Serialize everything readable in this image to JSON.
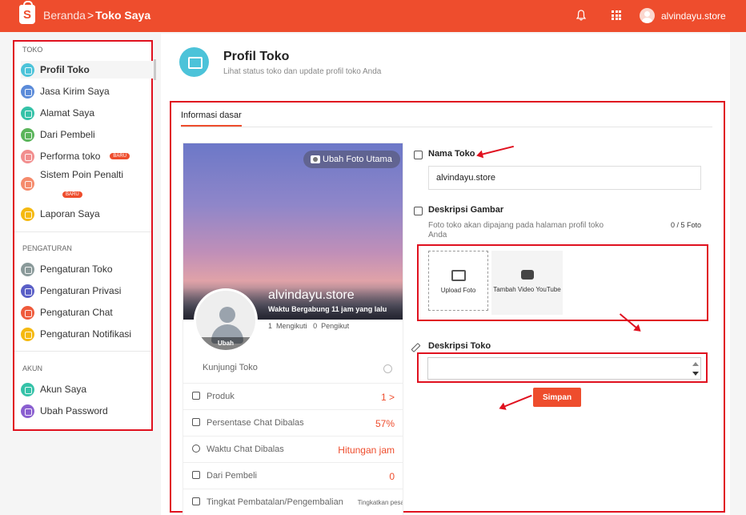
{
  "topbar": {
    "logo_letter": "S",
    "breadcrumb_home": "Beranda",
    "breadcrumb_sep": ">",
    "breadcrumb_current": "Toko Saya",
    "user_name": "alvindayu.store"
  },
  "sidebar": {
    "section_toko": "TOKO",
    "section_pengaturan": "PENGATURAN",
    "section_akun": "AKUN",
    "badge_new": "BARU",
    "toko_items": [
      {
        "label": "Profil Toko",
        "color": "#4cc3d9"
      },
      {
        "label": "Jasa Kirim Saya",
        "color": "#5b8bd9"
      },
      {
        "label": "Alamat Saya",
        "color": "#35c2a8"
      },
      {
        "label": "Dari Pembeli",
        "color": "#5bb55b"
      },
      {
        "label": "Performa toko",
        "color": "#f28e8e"
      },
      {
        "label": "Sistem Poin Penalti",
        "color": "#f58b6c"
      },
      {
        "label": "Laporan Saya",
        "color": "#f5b90f"
      }
    ],
    "pengaturan_items": [
      {
        "label": "Pengaturan Toko",
        "color": "#8a9a9a"
      },
      {
        "label": "Pengaturan Privasi",
        "color": "#5a5fc7"
      },
      {
        "label": "Pengaturan Chat",
        "color": "#ef5b3c"
      },
      {
        "label": "Pengaturan Notifikasi",
        "color": "#f5b90f"
      }
    ],
    "akun_items": [
      {
        "label": "Akun Saya",
        "color": "#35c2a8"
      },
      {
        "label": "Ubah Password",
        "color": "#8a5fd0"
      }
    ]
  },
  "header": {
    "title": "Profil Toko",
    "subtitle": "Lihat status toko dan update profil toko Anda"
  },
  "tabs": {
    "active": "Informasi dasar"
  },
  "profile_card": {
    "cover_button": "Ubah Foto Utama",
    "shop_name": "alvindayu.store",
    "joined": "Waktu Bergabung 11 jam yang lalu",
    "followers_count": "1",
    "followers_label": "Mengikuti",
    "following_count": "0",
    "following_label": "Pengikut",
    "avatar_change": "Ubah",
    "visit_label": "Kunjungi Toko",
    "stats": [
      {
        "label": "Produk",
        "value": "1 >"
      },
      {
        "label": "Persentase Chat Dibalas",
        "value": "57%"
      },
      {
        "label": "Waktu Chat Dibalas",
        "value": "Hitungan jam"
      },
      {
        "label": "Dari Pembeli",
        "value": "0"
      },
      {
        "label": "Tingkat Pembatalan/Pengembalian",
        "value": "Tingkatkan pesa"
      }
    ]
  },
  "form": {
    "name_label": "Nama Toko",
    "name_value": "alvindayu.store",
    "image_label": "Deskripsi Gambar",
    "image_hint": "Foto toko akan dipajang pada halaman profil toko Anda",
    "image_count": "0 / 5 Foto",
    "upload_label": "Upload Foto",
    "video_label": "Tambah Video YouTube",
    "desc_label": "Deskripsi Toko",
    "save_label": "Simpan"
  }
}
